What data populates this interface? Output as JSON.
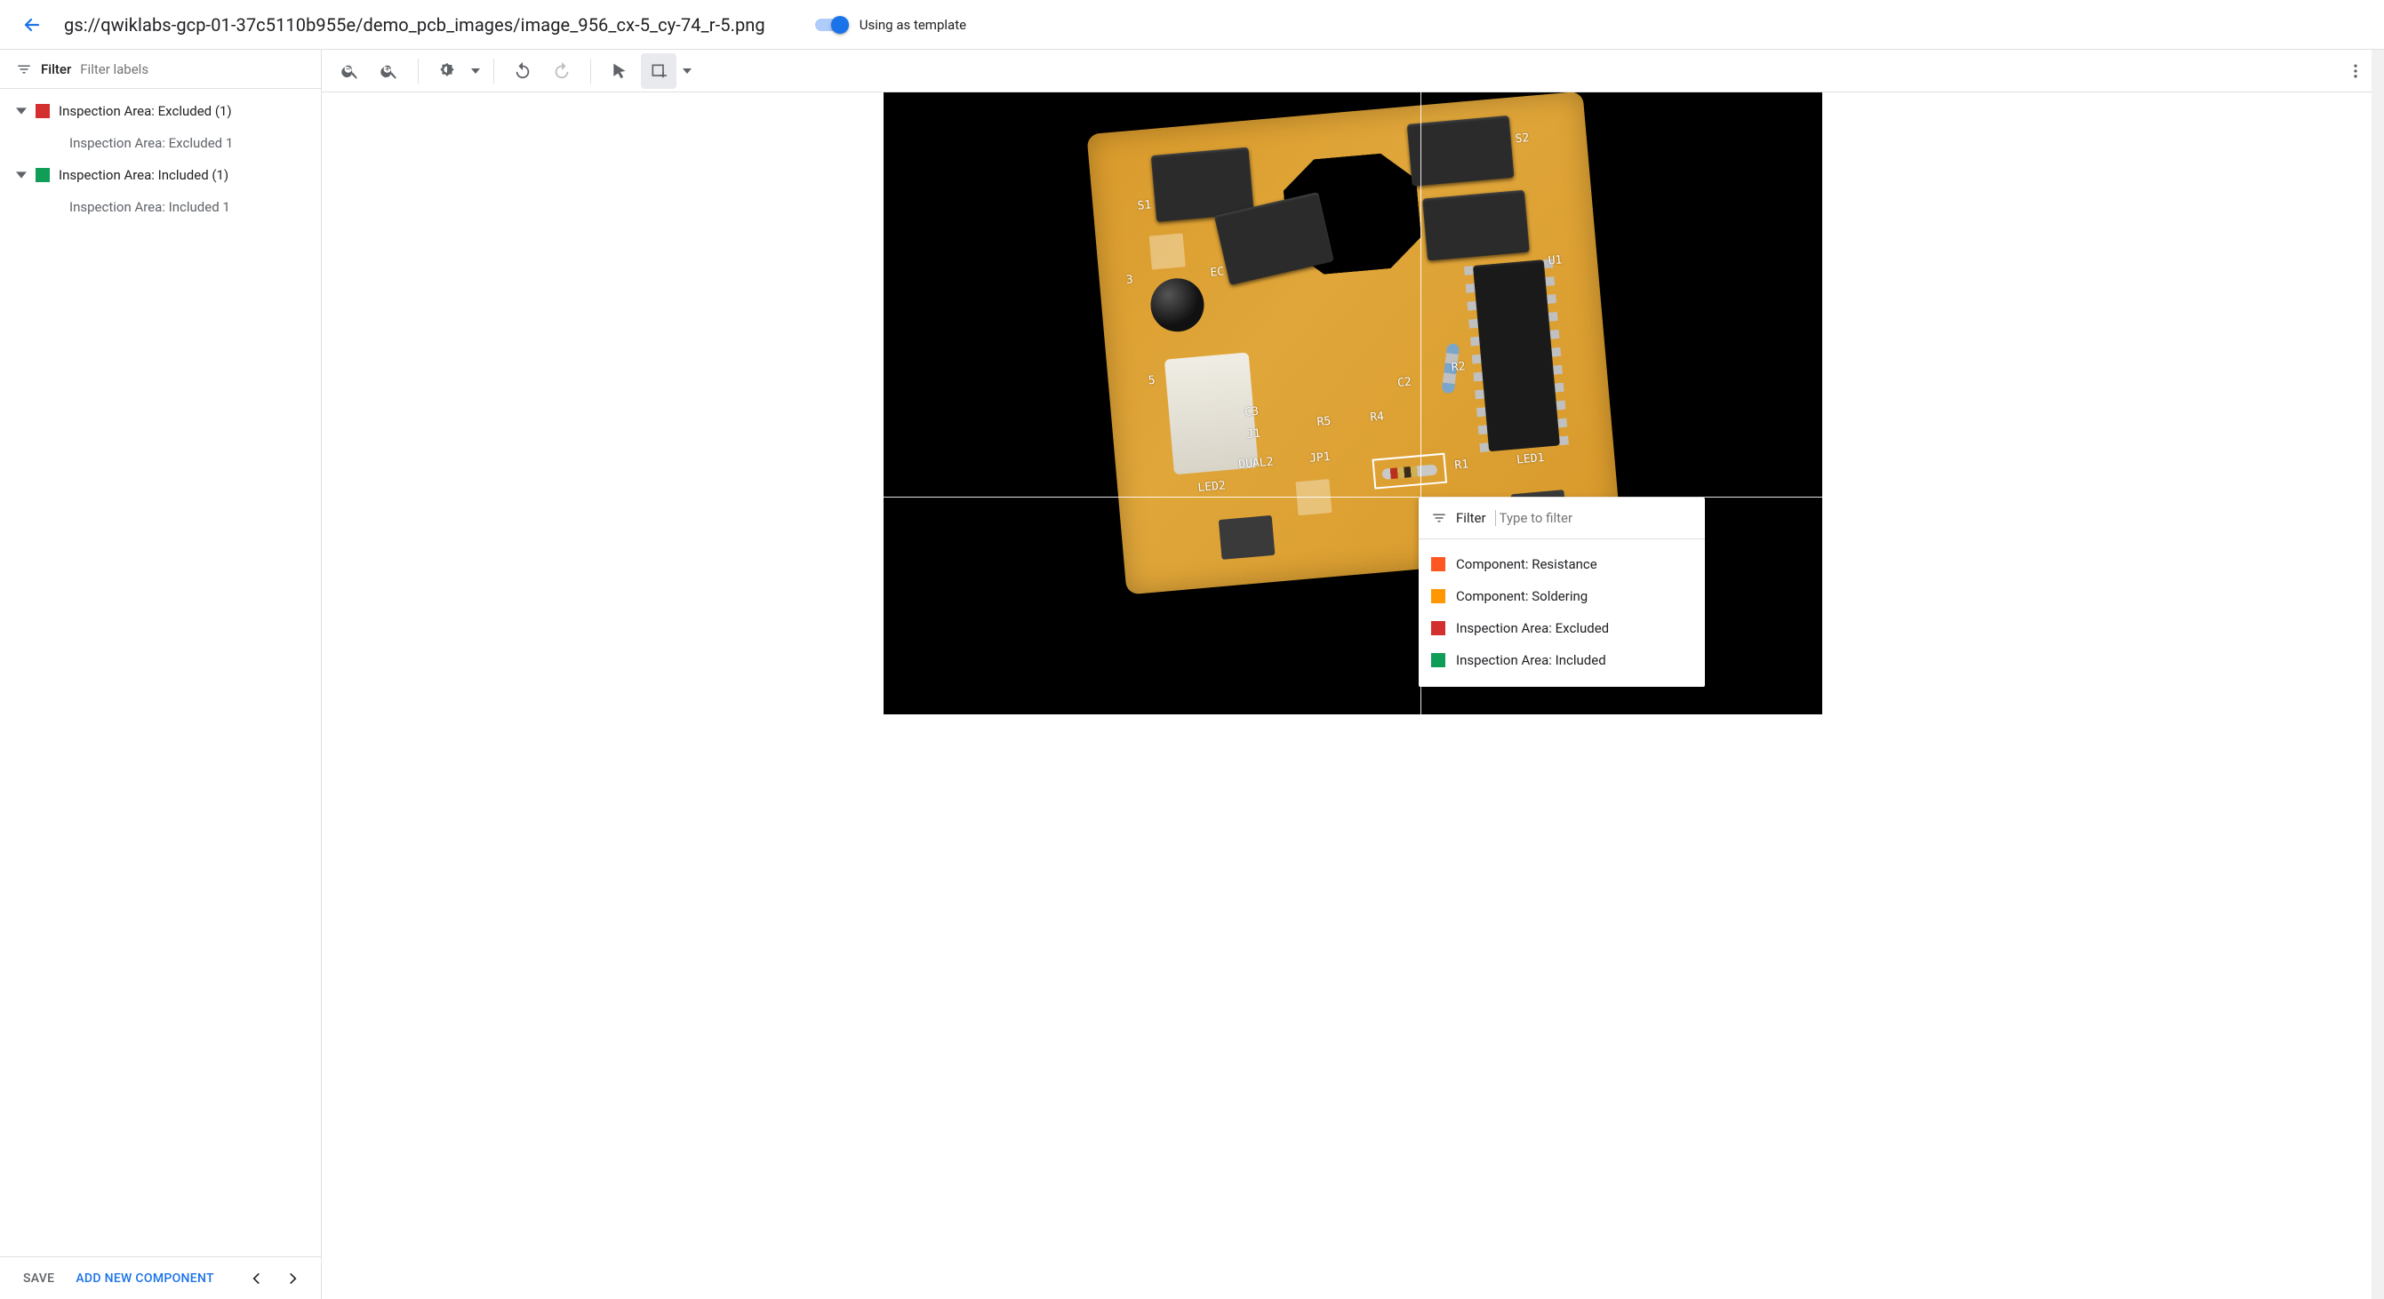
{
  "header": {
    "path": "gs://qwiklabs-gcp-01-37c5110b955e/demo_pcb_images/image_956_cx-5_cy-74_r-5.png",
    "toggle_label": "Using as template",
    "toggle_on": true
  },
  "sidebar": {
    "filter_label": "Filter",
    "filter_placeholder": "Filter labels",
    "groups": [
      {
        "color": "#d32f2f",
        "label": "Inspection Area: Excluded (1)",
        "items": [
          "Inspection Area: Excluded 1"
        ]
      },
      {
        "color": "#0f9d58",
        "label": "Inspection Area: Included (1)",
        "items": [
          "Inspection Area: Included 1"
        ]
      }
    ],
    "save_label": "SAVE",
    "add_component_label": "ADD NEW COMPONENT"
  },
  "popover": {
    "filter_label": "Filter",
    "filter_placeholder": "Type to filter",
    "options": [
      {
        "color": "#ff5722",
        "label": "Component: Resistance"
      },
      {
        "color": "#ff9800",
        "label": "Component: Soldering"
      },
      {
        "color": "#d32f2f",
        "label": "Inspection Area: Excluded"
      },
      {
        "color": "#0f9d58",
        "label": "Inspection Area: Included"
      }
    ]
  },
  "pcb_labels": {
    "s1": "S1",
    "s2": "S2",
    "three": "3",
    "five": "5",
    "u1": "U1",
    "c2": "C2",
    "c3": "C3",
    "j1": "J1",
    "r2": "R2",
    "r4": "R4",
    "r5": "R5",
    "r1": "R1",
    "jp1": "JP1",
    "dual2": "DUAL2",
    "led1": "LED1",
    "led2": "LED2",
    "ec": "EC"
  }
}
